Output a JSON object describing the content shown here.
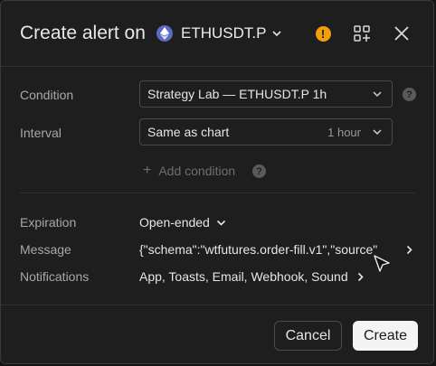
{
  "header": {
    "title": "Create alert on",
    "symbol": "ETHUSDT.P",
    "warn_glyph": "!"
  },
  "condition": {
    "label": "Condition",
    "value": "Strategy Lab — ETHUSDT.P 1h"
  },
  "interval": {
    "label": "Interval",
    "value": "Same as chart",
    "sub": "1 hour"
  },
  "add_condition": {
    "label": "Add condition"
  },
  "help_glyph": "?",
  "expiration": {
    "label": "Expiration",
    "value": "Open-ended"
  },
  "message": {
    "label": "Message",
    "value": "{\"schema\":\"wtfutures.order-fill.v1\",\"source\""
  },
  "notifications": {
    "label": "Notifications",
    "value": "App, Toasts, Email, Webhook, Sound"
  },
  "footer": {
    "cancel_label": "Cancel",
    "create_label": "Create"
  },
  "colors": {
    "warning": "#f29d0b",
    "eth": "#5c6bc0",
    "primary_button": "#f4f4f4"
  }
}
